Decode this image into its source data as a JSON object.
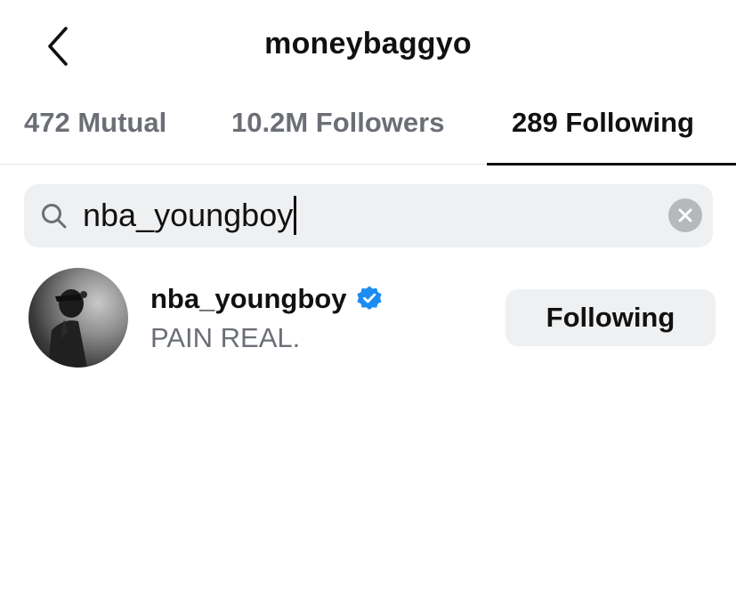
{
  "header": {
    "title": "moneybaggyo",
    "back_icon": "chevron-left-icon"
  },
  "tabs": [
    {
      "label": "472 Mutual",
      "active": false
    },
    {
      "label": "10.2M Followers",
      "active": false
    },
    {
      "label": "289 Following",
      "active": true
    }
  ],
  "search": {
    "icon": "search-icon",
    "value": "nba_youngboy",
    "clear_icon": "clear-icon"
  },
  "results": [
    {
      "username": "nba_youngboy",
      "verified": true,
      "bio": "PAIN REAL.",
      "button_label": "Following"
    }
  ],
  "colors": {
    "text_primary": "#111111",
    "text_secondary": "#6b6f75",
    "surface": "#eff0f2",
    "verified_blue": "#1a8cf2"
  }
}
